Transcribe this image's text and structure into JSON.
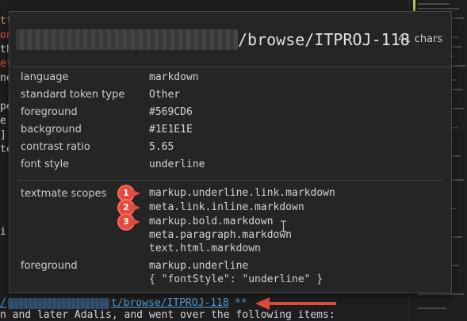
{
  "editor": {
    "left_fragments": [
      "tt",
      "on",
      "th",
      "et",
      "ne",
      "",
      "",
      "pe",
      "e",
      "]",
      "te",
      "",
      "",
      "",
      "",
      "i"
    ],
    "bottom_link_suffix": "t/browse/ITPROJ-118",
    "bottom_link_prefix": "/",
    "bottom_stars": "**",
    "bottom_last_line": "n and later Adalis, and went over the following items:"
  },
  "hover": {
    "header_url": "/browse/ITPROJ-118",
    "header_chars": "41 chars",
    "properties": [
      {
        "label": "language",
        "value": "markdown"
      },
      {
        "label": "standard token type",
        "value": "Other"
      },
      {
        "label": "foreground",
        "value": "#569CD6"
      },
      {
        "label": "background",
        "value": "#1E1E1E"
      },
      {
        "label": "contrast ratio",
        "value": "5.65"
      },
      {
        "label": "font style",
        "value": "underline"
      }
    ],
    "textmate_label": "textmate scopes",
    "scopes": [
      "markup.underline.link.markdown",
      "meta.link.inline.markdown",
      "markup.bold.markdown",
      "meta.paragraph.markdown",
      "text.html.markdown"
    ],
    "badges": [
      "1",
      "2",
      "3"
    ],
    "foreground_label": "foreground",
    "foreground_rule": [
      "markup.underline",
      "{ \"fontStyle\": \"underline\" }"
    ]
  },
  "colors": {
    "annotation_red": "#e04a3f",
    "link_blue": "#569CD6",
    "panel_bg": "#252526",
    "editor_bg": "#1E1E1E"
  }
}
